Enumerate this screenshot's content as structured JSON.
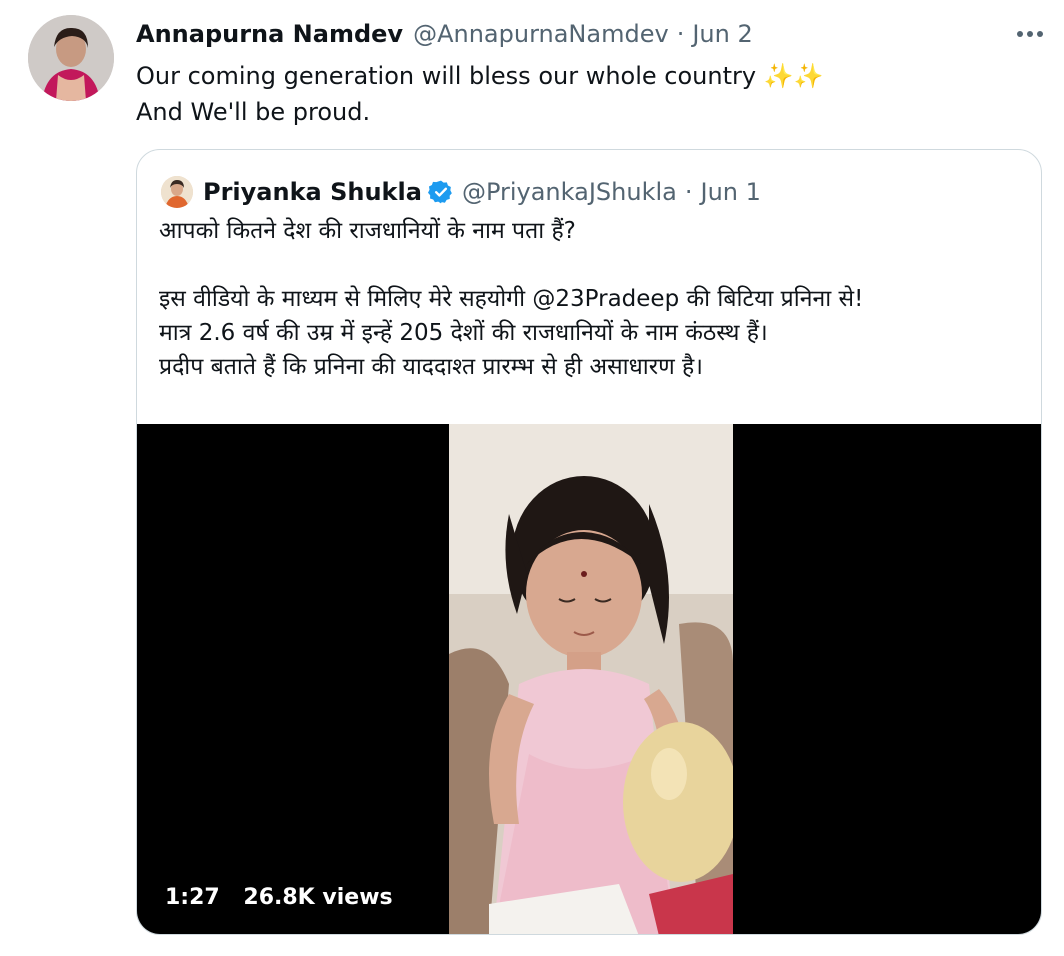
{
  "tweet": {
    "author_name": "Annapurna Namdev",
    "author_handle": "@AnnapurnaNamdev",
    "separator": "·",
    "date": "Jun 2",
    "line1": "Our coming generation will bless our whole country",
    "line1_emoji": "✨✨",
    "line2": "And We'll be proud.",
    "more_icon": "more-horizontal-icon"
  },
  "quote": {
    "author_name": "Priyanka Shukla",
    "author_handle": "@PriyankaJShukla",
    "separator": "·",
    "date": "Jun 1",
    "verified_icon": "verified-badge-icon",
    "verified_color": "#1d9bf0",
    "line1": "आपको कितने देश की राजधानियों के नाम पता  हैं?",
    "line2": "इस वीडियो के माध्यम से मिलिए मेरे सहयोगी @23Pradeep की बिटिया प्रनिना से!",
    "line3": "मात्र 2.6 वर्ष की उम्र में इन्हें 205 देशों की राजधानियों के नाम कंठस्थ हैं।",
    "line4": "प्रदीप बताते हैं कि प्रनिना की याददाश्त प्रारम्भ से ही असाधारण है।"
  },
  "video": {
    "duration": "1:27",
    "views": "26.8K views"
  }
}
